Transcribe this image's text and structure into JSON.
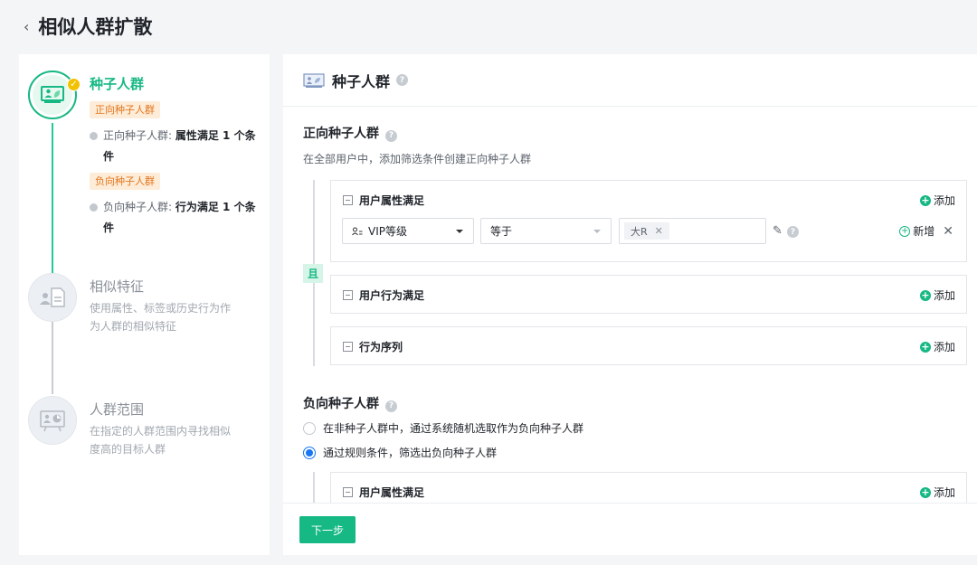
{
  "header": {
    "back_icon": "chevron-left-icon",
    "title": "相似人群扩散"
  },
  "steps": [
    {
      "title": "种子人群",
      "positive_tag": "正向种子人群",
      "positive_cond_prefix": "正向种子人群:",
      "positive_cond_value": "属性满足 1 个条",
      "positive_cond_wrap": "件",
      "negative_tag": "负向种子人群",
      "negative_cond_prefix": "负向种子人群:",
      "negative_cond_value": "行为满足 1 个条",
      "negative_cond_wrap": "件"
    },
    {
      "title": "相似特征",
      "desc": "使用属性、标签或历史行为作为人群的相似特征"
    },
    {
      "title": "人群范围",
      "desc": "在指定的人群范围内寻找相似度高的目标人群"
    }
  ],
  "main": {
    "title": "种子人群",
    "positive": {
      "title": "正向种子人群",
      "subtitle": "在全部用户中，添加筛选条件创建正向种子人群",
      "and_label": "且",
      "attr_box": {
        "title": "用户属性满足",
        "add": "添加",
        "field": "VIP等级",
        "operator": "等于",
        "chip": "大R",
        "new": "新增"
      },
      "behavior_box": {
        "title": "用户行为满足",
        "add": "添加"
      },
      "sequence_box": {
        "title": "行为序列",
        "add": "添加"
      }
    },
    "negative": {
      "title": "负向种子人群",
      "option1": "在非种子人群中，通过系统随机选取作为负向种子人群",
      "option2": "通过规则条件，筛选出负向种子人群",
      "attr_box": {
        "title": "用户属性满足",
        "add": "添加"
      }
    },
    "next": "下一步"
  },
  "colors": {
    "accent": "#16b884",
    "tag_orange": "#e3761e",
    "radio": "#1877f2"
  }
}
